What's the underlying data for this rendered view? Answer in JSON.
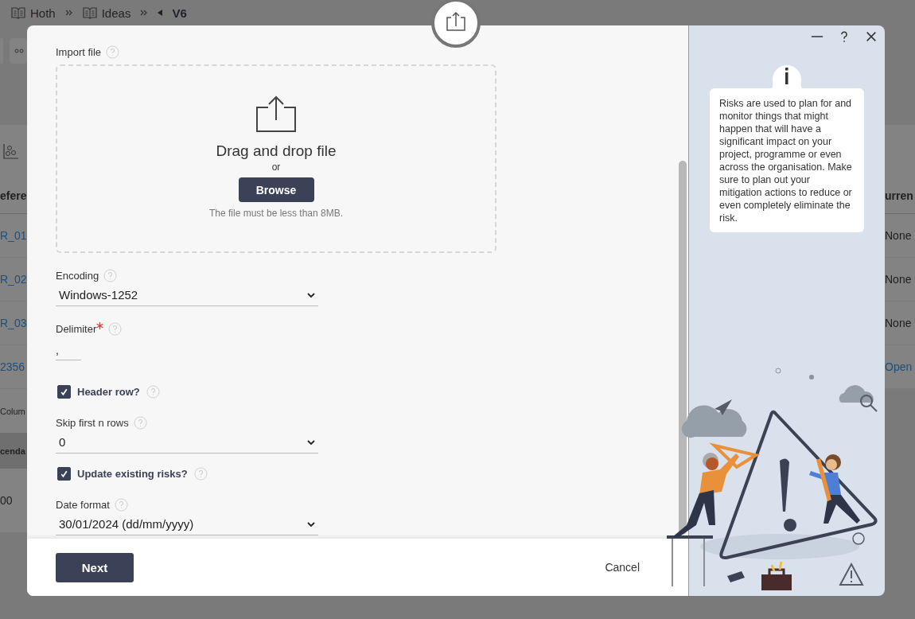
{
  "breadcrumb": [
    {
      "label": "Hoth",
      "kind": "book"
    },
    {
      "label": "Ideas",
      "kind": "book"
    },
    {
      "label": "V6",
      "kind": "current"
    }
  ],
  "background": {
    "left_header": "efere",
    "left_cells": [
      {
        "text": "R_01",
        "kind": "link"
      },
      {
        "text": "R_02",
        "kind": "link"
      },
      {
        "text": "R_03",
        "kind": "link"
      },
      {
        "text": "2356",
        "kind": "link"
      }
    ],
    "left_footer": "Colum",
    "left_pill": "cenda",
    "left_value": "00",
    "right_header": "urren",
    "right_cells": [
      {
        "text": "None",
        "kind": "text"
      },
      {
        "text": "None",
        "kind": "text"
      },
      {
        "text": "None",
        "kind": "text"
      },
      {
        "text": "Open",
        "kind": "link"
      }
    ]
  },
  "dialog": {
    "import_file": {
      "label": "Import file",
      "drop_title": "Drag and drop file",
      "or": "or",
      "browse": "Browse",
      "note": "The file must be less than 8MB."
    },
    "fields": [
      {
        "kind": "select",
        "label": "Encoding",
        "value": "Windows-1252",
        "required": false
      },
      {
        "kind": "text",
        "label": "Delimiter",
        "value": ",",
        "required": true
      },
      {
        "kind": "checkbox",
        "label": "Header row?",
        "checked": true
      },
      {
        "kind": "select",
        "label": "Skip first n rows",
        "value": "0",
        "required": false
      },
      {
        "kind": "checkbox",
        "label": "Update existing risks?",
        "checked": true
      },
      {
        "kind": "select",
        "label": "Date format",
        "value": "30/01/2024 (dd/mm/yyyy)",
        "required": false
      }
    ],
    "next": "Next",
    "cancel": "Cancel"
  },
  "help_panel": {
    "text": "Risks are used to plan for and monitor things that might happen that will have a significant impact on your project, programme or even across the organisation. Make sure to plan out your mitigation actions to reduce or even completely eliminate the risk."
  }
}
